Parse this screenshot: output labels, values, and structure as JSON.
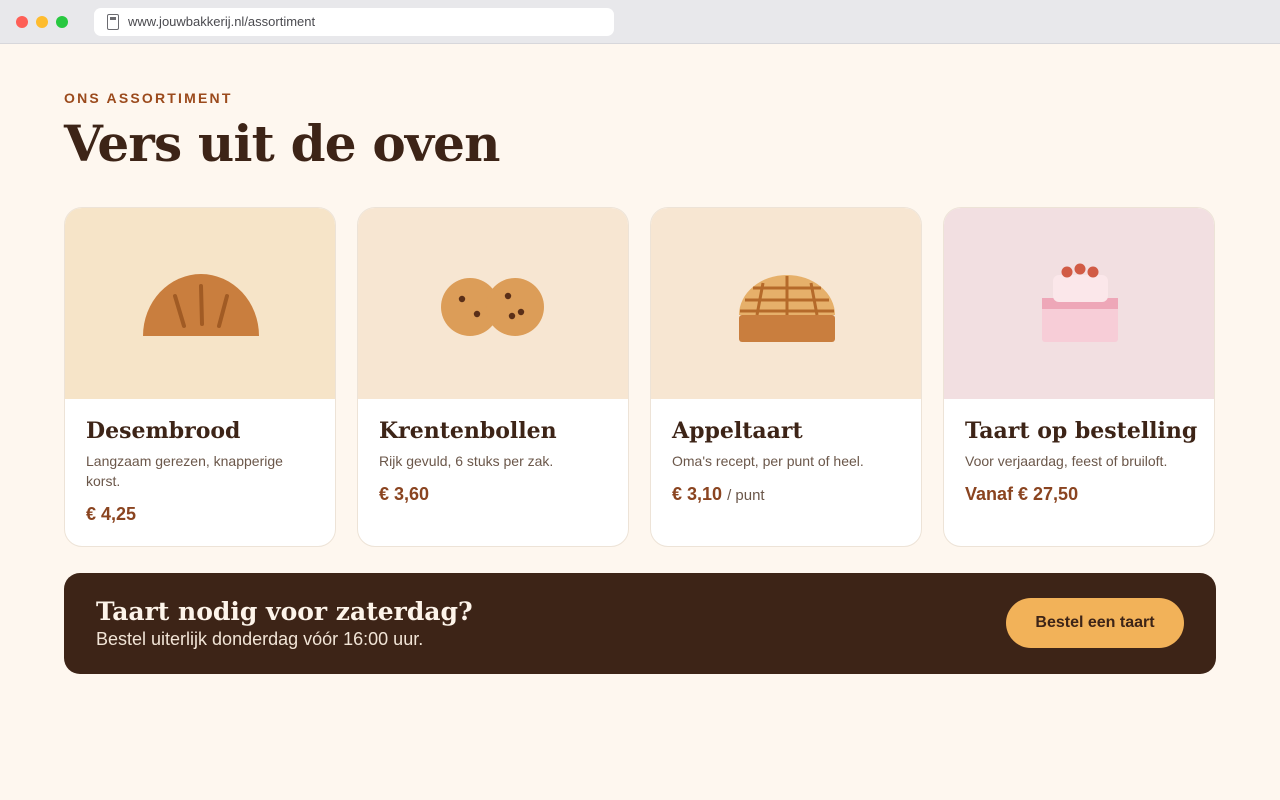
{
  "browser": {
    "url": "www.jouwbakkerij.nl/assortiment"
  },
  "header": {
    "eyebrow": "ONS ASSORTIMENT",
    "title": "Vers uit de oven"
  },
  "products": [
    {
      "name": "Desembrood",
      "description": "Langzaam gerezen, knapperige korst.",
      "price": "€ 4,25",
      "unit": "",
      "icon": "bread-icon",
      "image_bg": "#f6e4c8"
    },
    {
      "name": "Krentenbollen",
      "description": "Rijk gevuld, 6 stuks per zak.",
      "price": "€ 3,60",
      "unit": "",
      "icon": "buns-icon",
      "image_bg": "#f7e6d2"
    },
    {
      "name": "Appeltaart",
      "description": "Oma's recept, per punt of heel.",
      "price": "€ 3,10",
      "unit": "/ punt",
      "icon": "apple-pie-icon",
      "image_bg": "#f7e6d2"
    },
    {
      "name": "Taart op bestelling",
      "description": "Voor verjaardag, feest of bruiloft.",
      "price": "Vanaf € 27,50",
      "unit": "",
      "icon": "cake-icon",
      "image_bg": "#f2dfe1"
    }
  ],
  "banner": {
    "title": "Taart nodig voor zaterdag?",
    "subtitle": "Bestel uiterlijk donderdag vóór 16:00 uur.",
    "button_label": "Bestel een taart"
  },
  "colors": {
    "page_bg": "#fef7ef",
    "accent": "#8a4420",
    "dark": "#3d2417",
    "button": "#f2b259"
  }
}
